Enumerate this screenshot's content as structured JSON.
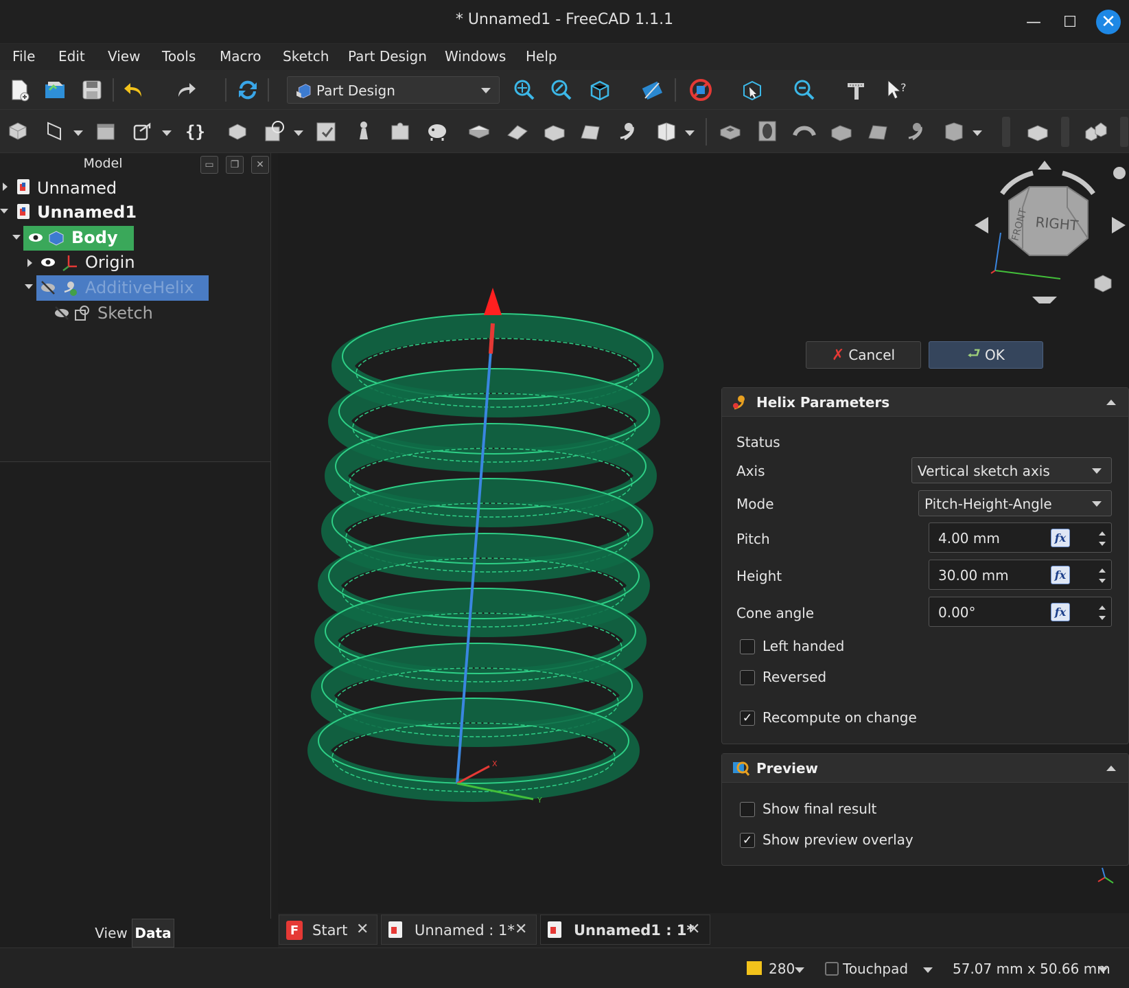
{
  "window": {
    "title": "* Unnamed1 - FreeCAD 1.1.1",
    "minimize_label": "—",
    "maximize_label": "☐",
    "close_label": "✕"
  },
  "menu": {
    "items": [
      "File",
      "Edit",
      "View",
      "Tools",
      "Macro",
      "Sketch",
      "Part Design",
      "Windows",
      "Help"
    ]
  },
  "toolbar": {
    "workbench": "Part Design"
  },
  "model_panel": {
    "title": "Model",
    "tree": [
      {
        "label": "Unnamed"
      },
      {
        "label": "Unnamed1"
      },
      {
        "label": "Body"
      },
      {
        "label": "Origin"
      },
      {
        "label": "AdditiveHelix"
      },
      {
        "label": "Sketch"
      }
    ],
    "tabs": [
      "View",
      "Data"
    ]
  },
  "task_panel": {
    "cancel_label": "Cancel",
    "ok_label": "OK",
    "helix": {
      "title": "Helix Parameters",
      "status_label": "Status",
      "axis_label": "Axis",
      "axis_value": "Vertical sketch axis",
      "mode_label": "Mode",
      "mode_value": "Pitch-Height-Angle",
      "pitch_label": "Pitch",
      "pitch_value": "4.00 mm",
      "height_label": "Height",
      "height_value": "30.00 mm",
      "cone_label": "Cone angle",
      "cone_value": "0.00°",
      "fx_label": "fx",
      "left_handed_label": "Left handed",
      "left_handed": false,
      "reversed_label": "Reversed",
      "reversed": false,
      "recompute_label": "Recompute on change",
      "recompute": true
    },
    "preview": {
      "title": "Preview",
      "show_final_label": "Show final result",
      "show_final": false,
      "show_overlay_label": "Show preview overlay",
      "show_overlay": true
    }
  },
  "navcube": {
    "front": "FRONT",
    "right": "RIGHT"
  },
  "doc_tabs": [
    {
      "label": "Start"
    },
    {
      "label": "Unnamed : 1*"
    },
    {
      "label": "Unnamed1 : 1*"
    }
  ],
  "status": {
    "count": "280",
    "navigation": "Touchpad",
    "dimensions": "57.07 mm x 50.66 mm"
  },
  "colors": {
    "helix": "#2ecf86",
    "highlight_body": "#3aa85a",
    "highlight_helix": "#4a7cc4",
    "accent": "#1e88e5"
  }
}
